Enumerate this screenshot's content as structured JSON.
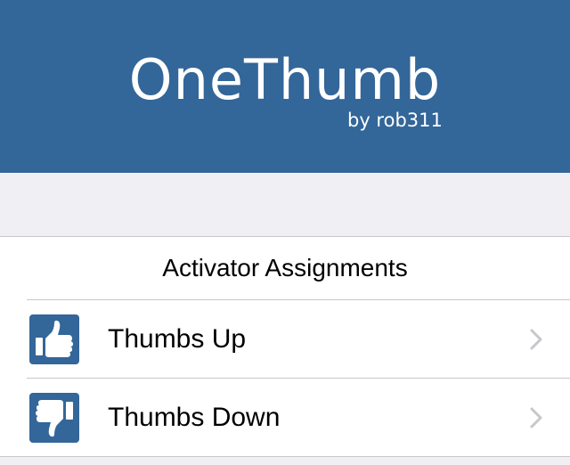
{
  "header": {
    "title": "OneThumb",
    "byline": "by rob311",
    "background_color": "#336699"
  },
  "group": {
    "title": "Activator Assignments",
    "items": [
      {
        "label": "Thumbs Up",
        "icon": "thumbs-up-icon",
        "accessory": "chevron-right-icon"
      },
      {
        "label": "Thumbs Down",
        "icon": "thumbs-down-icon",
        "accessory": "chevron-right-icon"
      }
    ]
  },
  "colors": {
    "accent": "#336699",
    "background": "#efeff4",
    "separator": "#c8c7cc",
    "chevron": "#c7c7cc"
  }
}
